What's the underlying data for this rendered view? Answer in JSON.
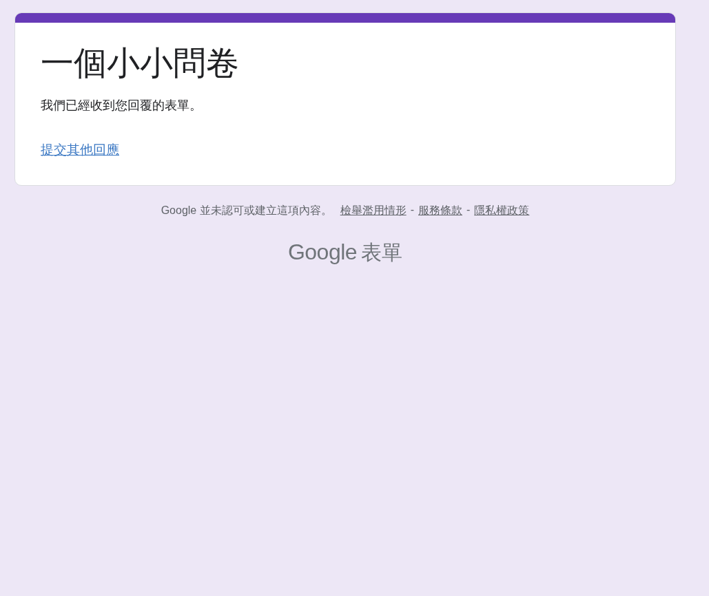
{
  "form": {
    "title": "一個小小問卷",
    "message": "我們已經收到您回覆的表單。",
    "link": "提交其他回應"
  },
  "footer": {
    "disclaimer": "Google 並未認可或建立這項內容。",
    "links": [
      {
        "label": "檢舉濫用情形"
      },
      {
        "label": "服務條款"
      },
      {
        "label": "隱私權政策"
      }
    ],
    "separator": "-"
  },
  "logo": {
    "brand": "Google",
    "product": "表單"
  }
}
